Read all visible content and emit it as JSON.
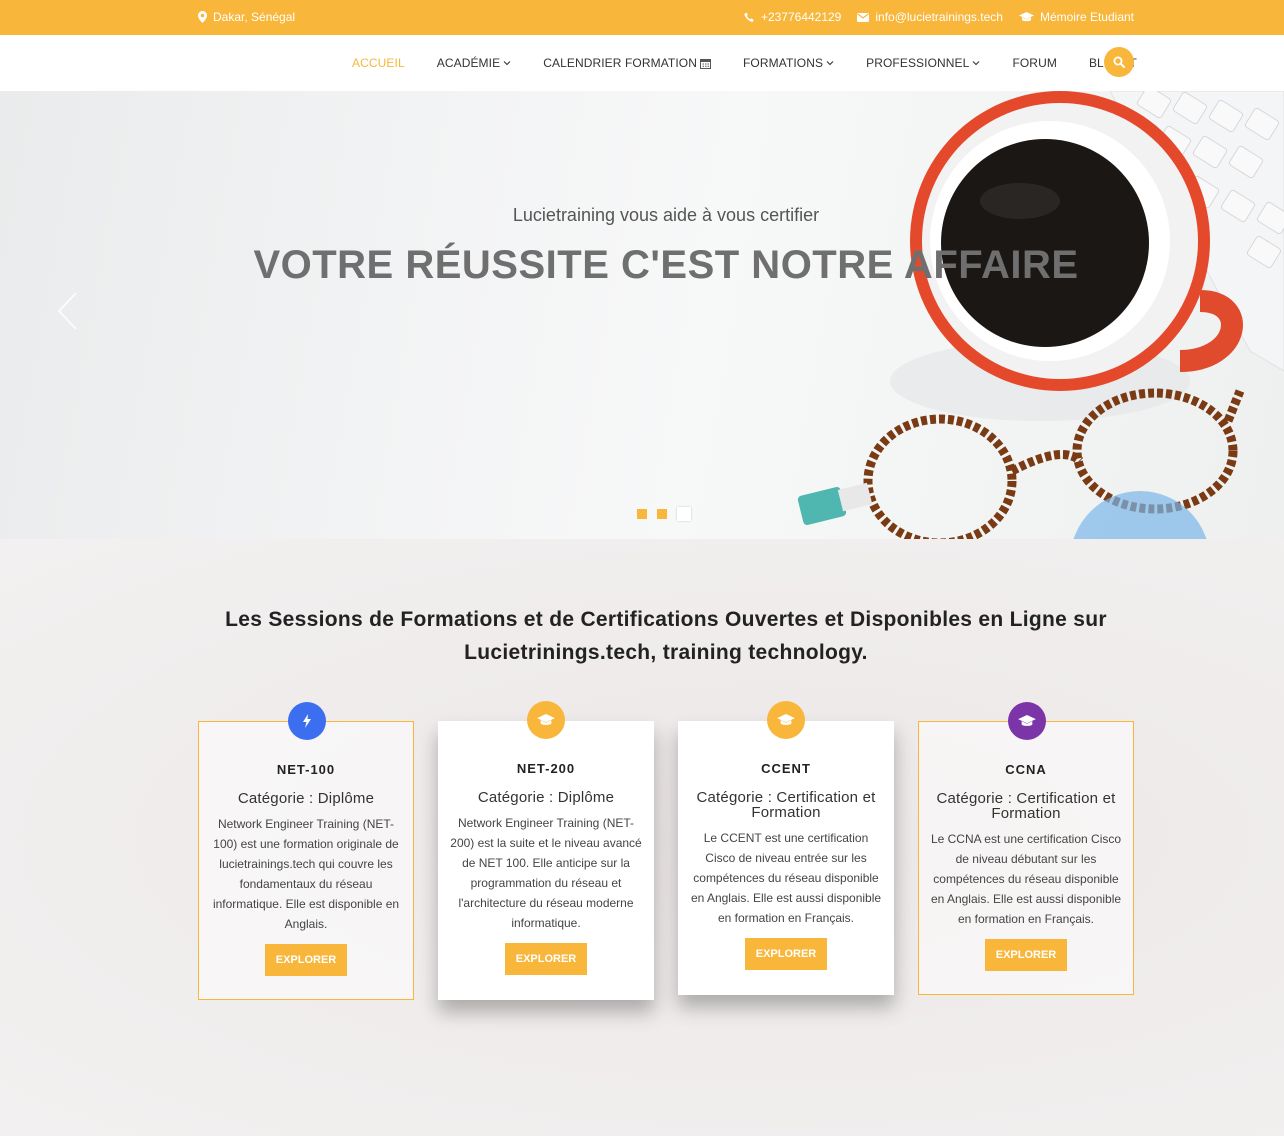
{
  "topbar": {
    "location": "Dakar, Sénégal",
    "phone": "+23776442129",
    "email": "info@lucietrainings.tech",
    "memoire": "Mémoire Etudiant"
  },
  "nav": {
    "items": [
      {
        "label": "ACCUEIL",
        "active": true
      },
      {
        "label": "ACADÉMIE",
        "dropdown": true
      },
      {
        "label": "CALENDRIER FORMATION",
        "icon": "calendar-icon"
      },
      {
        "label": "FORMATIONS",
        "dropdown": true
      },
      {
        "label": "PROFESSIONNEL",
        "dropdown": true
      },
      {
        "label": "FORUM"
      },
      {
        "label": "BLOG IT"
      }
    ],
    "search_icon": "search-icon"
  },
  "hero": {
    "kicker": "Lucietraining vous aide à vous certifier",
    "headline": "VOTRE RÉUSSITE C'EST NOTRE AFFAIRE",
    "slides": 3,
    "active_slide": 3
  },
  "section": {
    "title": "Les Sessions de Formations et de Certifications Ouvertes et Disponibles en Ligne sur Lucietrinings.tech, training technology."
  },
  "cards": [
    {
      "code": "NET-100",
      "category": "Catégorie : Diplôme",
      "description": "Network Engineer Training (NET-100) est une formation originale de lucietrainings.tech qui couvre les fondamentaux du réseau informatique. Elle est disponible en Anglais.",
      "button": "EXPLORER",
      "icon": "bolt-icon",
      "icon_color": "#3b6ff0"
    },
    {
      "code": "NET-200",
      "category": "Catégorie : Diplôme",
      "description": "Network Engineer Training (NET-200) est la suite et le niveau avancé de NET 100. Elle anticipe sur la programmation du réseau et l'architecture du réseau moderne informatique.",
      "button": "EXPLORER",
      "icon": "graduation-cap-icon",
      "icon_color": "#f8b63a"
    },
    {
      "code": "CCENT",
      "category": "Catégorie : Certification et Formation",
      "description": "Le CCENT est une certification Cisco de niveau entrée sur les compétences du réseau disponible en Anglais. Elle est aussi disponible en formation en Français.",
      "button": "EXPLORER",
      "icon": "graduation-cap-icon",
      "icon_color": "#f8b63a"
    },
    {
      "code": "CCNA",
      "category": "Catégorie : Certification et Formation",
      "description": "Le CCNA est une certification Cisco de niveau débutant sur les compétences du réseau disponible en Anglais. Elle est aussi disponible en formation en Français.",
      "button": "EXPLORER",
      "icon": "graduation-cap-icon",
      "icon_color": "#7b35a8"
    }
  ]
}
